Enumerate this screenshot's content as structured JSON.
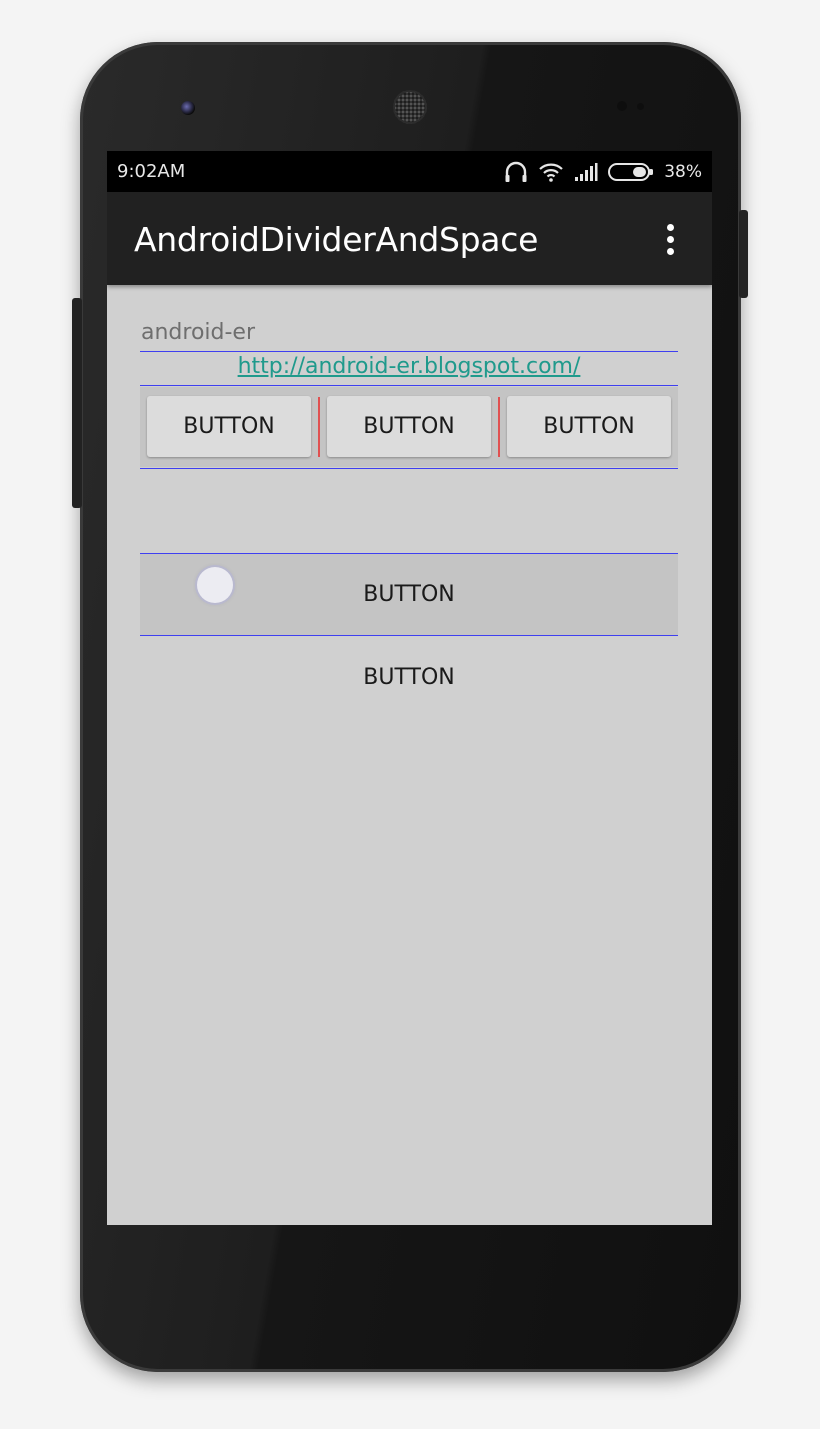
{
  "status_bar": {
    "time": "9:02AM",
    "battery_percent": "38%",
    "icons": [
      "headphones-icon",
      "wifi-icon",
      "cell-signal-icon",
      "battery-icon"
    ]
  },
  "action_bar": {
    "title": "AndroidDividerAndSpace",
    "overflow_icon": "overflow-menu-icon"
  },
  "content": {
    "site_label": "android-er",
    "link": "http://android-er.blogspot.com/",
    "button_row": [
      {
        "label": "BUTTON"
      },
      {
        "label": "BUTTON"
      },
      {
        "label": "BUTTON"
      }
    ],
    "bar_button": {
      "label": "BUTTON"
    },
    "plain_button": {
      "label": "BUTTON"
    }
  },
  "colors": {
    "divider_line": "#3f3ff0",
    "button_divider": "#e05050",
    "link": "#1f9a8c",
    "action_bar": "#212121",
    "screen_background": "#d0d0d0"
  }
}
